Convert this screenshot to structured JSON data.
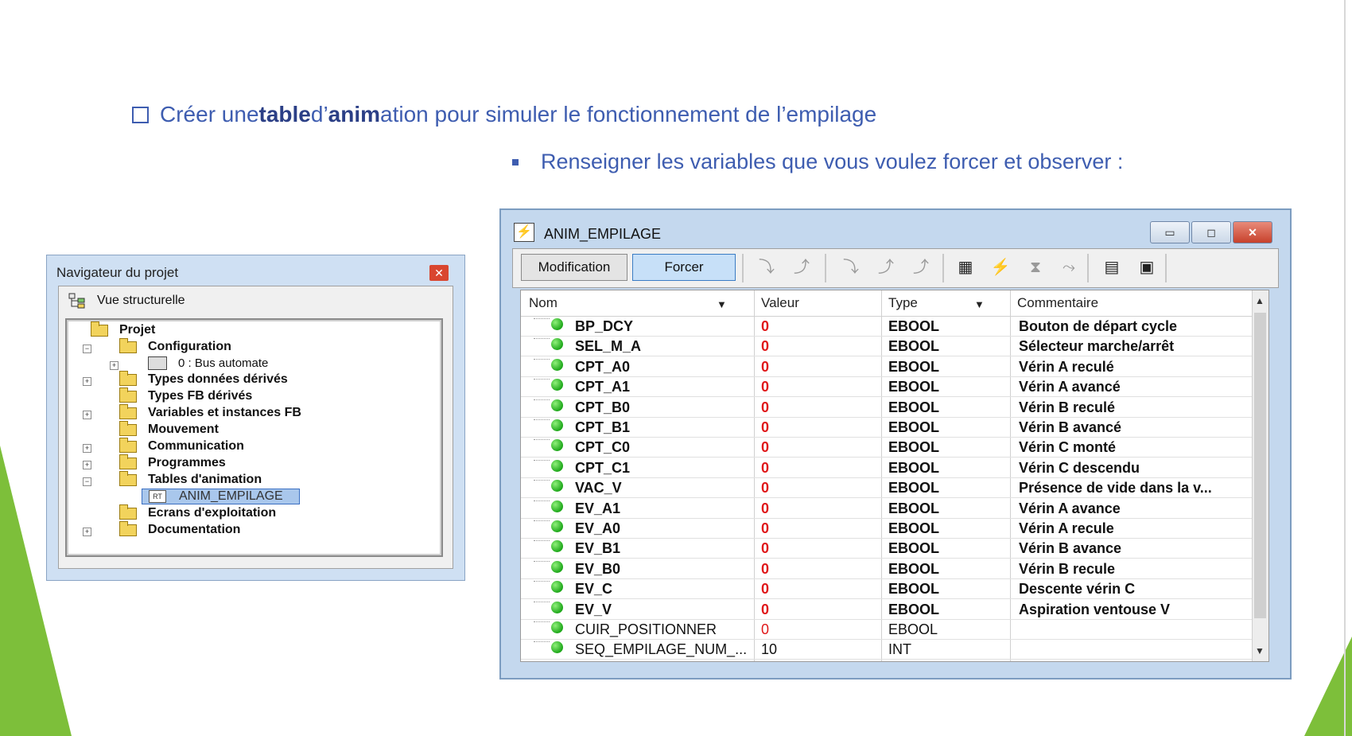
{
  "slide": {
    "bullet1_pre": "Créer une ",
    "bullet1_b1": "table",
    "bullet1_mid1": " d’",
    "bullet1_b2": "anim",
    "bullet1_post": "ation pour simuler le fonctionnement de l’empilage",
    "bullet2": "Renseigner les variables que vous voulez forcer et observer :"
  },
  "navigator": {
    "title": "Navigateur du projet",
    "view": "Vue structurelle",
    "tree": {
      "root": "Projet",
      "configuration": "Configuration",
      "bus": "0 : Bus automate",
      "types_derives": "Types données dérivés",
      "types_fb": "Types FB dérivés",
      "variables_fb": "Variables et instances FB",
      "mouvement": "Mouvement",
      "communication": "Communication",
      "programmes": "Programmes",
      "tables": "Tables d'animation",
      "anim": "ANIM_EMPILAGE",
      "ecrans": "Ecrans d'exploitation",
      "documentation": "Documentation"
    }
  },
  "anim_window": {
    "title": "ANIM_EMPILAGE",
    "tab_modification": "Modification",
    "tab_forcer": "Forcer",
    "columns": {
      "nom": "Nom",
      "valeur": "Valeur",
      "type": "Type",
      "commentaire": "Commentaire"
    },
    "rows": [
      {
        "nom": "BP_DCY",
        "valeur": "0",
        "type": "EBOOL",
        "commentaire": "Bouton de départ cycle"
      },
      {
        "nom": "SEL_M_A",
        "valeur": "0",
        "type": "EBOOL",
        "commentaire": "Sélecteur marche/arrêt"
      },
      {
        "nom": "CPT_A0",
        "valeur": "0",
        "type": "EBOOL",
        "commentaire": "Vérin A reculé"
      },
      {
        "nom": "CPT_A1",
        "valeur": "0",
        "type": "EBOOL",
        "commentaire": "Vérin A avancé"
      },
      {
        "nom": "CPT_B0",
        "valeur": "0",
        "type": "EBOOL",
        "commentaire": "Vérin B reculé"
      },
      {
        "nom": "CPT_B1",
        "valeur": "0",
        "type": "EBOOL",
        "commentaire": "Vérin B avancé"
      },
      {
        "nom": "CPT_C0",
        "valeur": "0",
        "type": "EBOOL",
        "commentaire": "Vérin C monté"
      },
      {
        "nom": "CPT_C1",
        "valeur": "0",
        "type": "EBOOL",
        "commentaire": "Vérin C descendu"
      },
      {
        "nom": "VAC_V",
        "valeur": "0",
        "type": "EBOOL",
        "commentaire": "Présence de vide dans la v..."
      },
      {
        "nom": "EV_A1",
        "valeur": "0",
        "type": "EBOOL",
        "commentaire": "Vérin A avance"
      },
      {
        "nom": "EV_A0",
        "valeur": "0",
        "type": "EBOOL",
        "commentaire": "Vérin A recule"
      },
      {
        "nom": "EV_B1",
        "valeur": "0",
        "type": "EBOOL",
        "commentaire": "Vérin B avance"
      },
      {
        "nom": "EV_B0",
        "valeur": "0",
        "type": "EBOOL",
        "commentaire": "Vérin B recule"
      },
      {
        "nom": "EV_C",
        "valeur": "0",
        "type": "EBOOL",
        "commentaire": "Descente vérin C"
      },
      {
        "nom": "EV_V",
        "valeur": "0",
        "type": "EBOOL",
        "commentaire": "Aspiration ventouse V"
      },
      {
        "nom": "CUIR_POSITIONNER",
        "valeur": "0",
        "type": "EBOOL",
        "commentaire": ""
      },
      {
        "nom": "SEQ_EMPILAGE_NUM_...",
        "valeur": "10",
        "type": "INT",
        "commentaire": ""
      }
    ]
  },
  "colors": {
    "accent_text": "#3e5db0",
    "green_shape": "#7dbf3a",
    "value_red": "#e0181a"
  }
}
